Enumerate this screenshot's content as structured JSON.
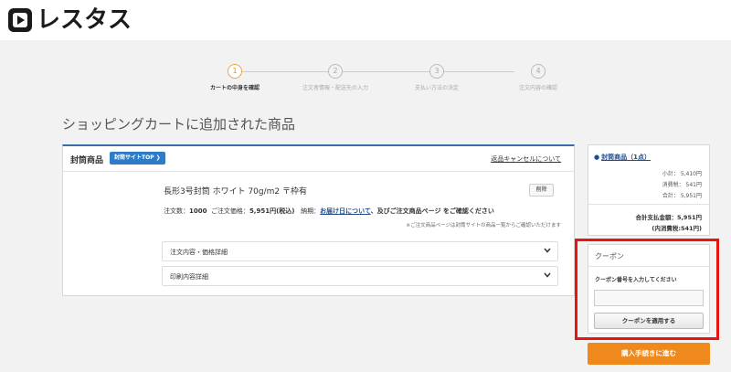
{
  "brand": {
    "name": "レスタス"
  },
  "steps": [
    {
      "num": "1",
      "label": "カートの中身を確認",
      "active": true
    },
    {
      "num": "2",
      "label": "注文者情報・配送先の入力",
      "active": false
    },
    {
      "num": "3",
      "label": "支払い方法の決定",
      "active": false
    },
    {
      "num": "4",
      "label": "注文内容の確認",
      "active": false
    }
  ],
  "page_title": "ショッピングカートに追加された商品",
  "cart": {
    "header_title": "封筒商品",
    "top_button": "封筒サイトTOP ❯",
    "cancel_link": "返品キャンセルについて",
    "item": {
      "name": "長形3号封筒 ホワイト 70g/m2 〒枠有",
      "delete_label": "削除",
      "qty_label": "注文数：",
      "qty_value": "1000",
      "price_label": "ご注文価格：",
      "price_value": "5,951円(税込)",
      "delivery_label": "納期：",
      "delivery_link": "お届け日について",
      "delivery_suffix": "、及びご注文商品ページ をご確認ください",
      "note": "※ご注文商品ページは封筒サイトの商品一覧からご確認いただけます"
    },
    "accordions": [
      {
        "label": "注文内容・価格詳細"
      },
      {
        "label": "印刷内容詳細"
      }
    ]
  },
  "summary": {
    "title": "封筒商品（1点）",
    "subtotal": "小計：  5,410円",
    "tax": "消費税：  541円",
    "total": "合計：  5,951円",
    "grand_total": "合計支払金額：5,951円",
    "grand_tax": "(内消費税:541円)"
  },
  "coupon": {
    "title": "クーポン",
    "label": "クーポン番号を入力してください",
    "input_value": "",
    "apply_button": "クーポンを適用する"
  },
  "buy_button": "購入手続きに進む",
  "colors": {
    "accent": "#f0891c",
    "link": "#1f4d8c",
    "highlight": "#e8140e",
    "button_blue": "#2e7cc7"
  }
}
